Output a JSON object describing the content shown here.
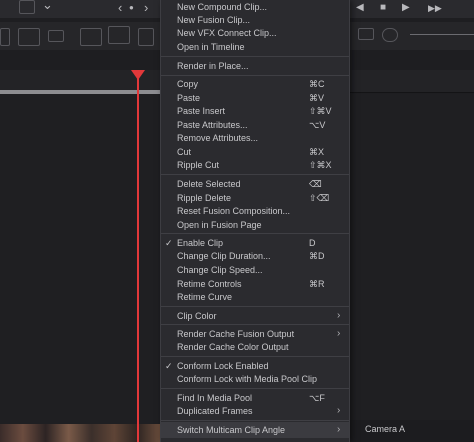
{
  "menu": {
    "items": [
      {
        "label": "New Compound Clip...",
        "shortcut": "",
        "check": false,
        "submenu": false
      },
      {
        "label": "New Fusion Clip...",
        "shortcut": "",
        "check": false,
        "submenu": false
      },
      {
        "label": "New VFX Connect Clip...",
        "shortcut": "",
        "check": false,
        "submenu": false
      },
      {
        "label": "Open in Timeline",
        "shortcut": "",
        "check": false,
        "submenu": false
      },
      {
        "label": "Render in Place...",
        "shortcut": "",
        "check": false,
        "submenu": false
      },
      {
        "label": "Copy",
        "shortcut": "⌘C",
        "check": false,
        "submenu": false
      },
      {
        "label": "Paste",
        "shortcut": "⌘V",
        "check": false,
        "submenu": false
      },
      {
        "label": "Paste Insert",
        "shortcut": "⇧⌘V",
        "check": false,
        "submenu": false
      },
      {
        "label": "Paste Attributes...",
        "shortcut": "⌥V",
        "check": false,
        "submenu": false
      },
      {
        "label": "Remove Attributes...",
        "shortcut": "",
        "check": false,
        "submenu": false
      },
      {
        "label": "Cut",
        "shortcut": "⌘X",
        "check": false,
        "submenu": false
      },
      {
        "label": "Ripple Cut",
        "shortcut": "⇧⌘X",
        "check": false,
        "submenu": false
      },
      {
        "label": "Delete Selected",
        "shortcut": "⌫",
        "check": false,
        "submenu": false
      },
      {
        "label": "Ripple Delete",
        "shortcut": "⇧⌫",
        "check": false,
        "submenu": false
      },
      {
        "label": "Reset Fusion Composition...",
        "shortcut": "",
        "check": false,
        "submenu": false
      },
      {
        "label": "Open in Fusion Page",
        "shortcut": "",
        "check": false,
        "submenu": false
      },
      {
        "label": "Enable Clip",
        "shortcut": "D",
        "check": true,
        "submenu": false
      },
      {
        "label": "Change Clip Duration...",
        "shortcut": "⌘D",
        "check": false,
        "submenu": false
      },
      {
        "label": "Change Clip Speed...",
        "shortcut": "",
        "check": false,
        "submenu": false
      },
      {
        "label": "Retime Controls",
        "shortcut": "⌘R",
        "check": false,
        "submenu": false
      },
      {
        "label": "Retime Curve",
        "shortcut": "",
        "check": false,
        "submenu": false
      },
      {
        "label": "Clip Color",
        "shortcut": "",
        "check": false,
        "submenu": true
      },
      {
        "label": "Render Cache Fusion Output",
        "shortcut": "",
        "check": false,
        "submenu": true
      },
      {
        "label": "Render Cache Color Output",
        "shortcut": "",
        "check": false,
        "submenu": false
      },
      {
        "label": "Conform Lock Enabled",
        "shortcut": "",
        "check": true,
        "submenu": false
      },
      {
        "label": "Conform Lock with Media Pool Clip",
        "shortcut": "",
        "check": false,
        "submenu": false
      },
      {
        "label": "Find In Media Pool",
        "shortcut": "⌥F",
        "check": false,
        "submenu": false
      },
      {
        "label": "Duplicated Frames",
        "shortcut": "",
        "check": false,
        "submenu": true
      },
      {
        "label": "Switch Multicam Clip Angle",
        "shortcut": "",
        "check": false,
        "submenu": true
      }
    ],
    "checkmark": "✓",
    "submenu_arrow": "›"
  },
  "submenu": {
    "first_item": "Camera A"
  },
  "toolbar": {
    "icons": [
      "trim-edit-icon",
      "chevron-down-icon",
      "chevron-left-icon",
      "dot-icon",
      "chevron-right-icon",
      "stop-icon",
      "play-icon",
      "skip-forward-icon"
    ],
    "glyphs": {
      "chev_down": "⌄",
      "left": "‹",
      "dot": "●",
      "right": "›",
      "stop": "■",
      "play": "▶",
      "prev": "◀",
      "next": "▶▶"
    }
  },
  "colors": {
    "playhead": "#e2383a",
    "menu_bg": "#2b2b2f",
    "highlight": "#3b3b40"
  }
}
